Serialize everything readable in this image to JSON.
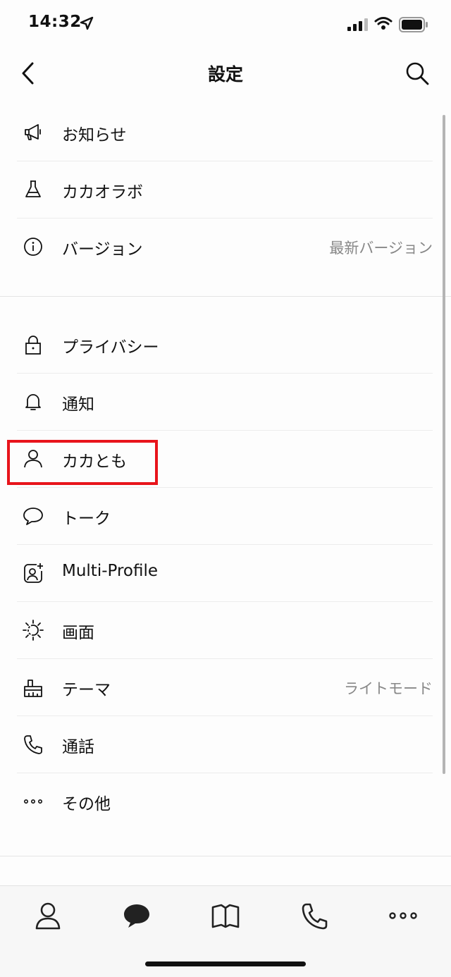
{
  "status_bar": {
    "time": "14:32"
  },
  "nav": {
    "title": "設定"
  },
  "sections": [
    {
      "items": [
        {
          "name": "announcements",
          "icon": "megaphone-icon",
          "label": "お知らせ",
          "value": ""
        },
        {
          "name": "kakao-lab",
          "icon": "flask-icon",
          "label": "カカオラボ",
          "value": ""
        },
        {
          "name": "version",
          "icon": "info-icon",
          "label": "バージョン",
          "value": "最新バージョン"
        }
      ]
    },
    {
      "items": [
        {
          "name": "privacy",
          "icon": "lock-icon",
          "label": "プライバシー",
          "value": ""
        },
        {
          "name": "notifications",
          "icon": "bell-icon",
          "label": "通知",
          "value": ""
        },
        {
          "name": "friends",
          "icon": "person-icon",
          "label": "カカとも",
          "value": ""
        },
        {
          "name": "chat",
          "icon": "speech-bubble-icon",
          "label": "トーク",
          "value": ""
        },
        {
          "name": "multi-profile",
          "icon": "profile-plus-icon",
          "label": "Multi-Profile",
          "value": ""
        },
        {
          "name": "display",
          "icon": "brightness-icon",
          "label": "画面",
          "value": ""
        },
        {
          "name": "theme",
          "icon": "paint-brush-icon",
          "label": "テーマ",
          "value": "ライトモード"
        },
        {
          "name": "calls",
          "icon": "phone-icon",
          "label": "通話",
          "value": ""
        },
        {
          "name": "others",
          "icon": "more-dots-icon",
          "label": "その他",
          "value": ""
        }
      ]
    }
  ],
  "highlight": {
    "target": "カカとも",
    "color": "#e8141b"
  },
  "tab_bar": [
    "friends-tab-icon",
    "chats-tab-icon",
    "view-tab-icon",
    "calls-tab-icon",
    "more-tab-icon"
  ]
}
